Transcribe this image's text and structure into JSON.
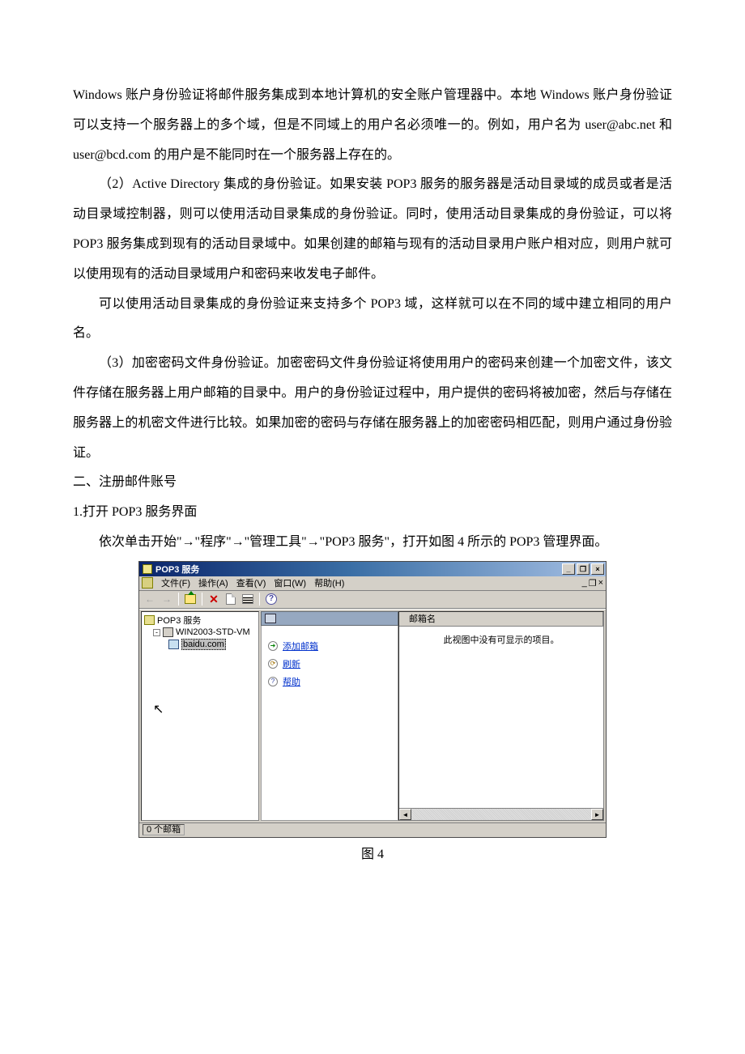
{
  "paragraphs": {
    "p1": "Windows 账户身份验证将邮件服务集成到本地计算机的安全账户管理器中。本地 Windows 账户身份验证可以支持一个服务器上的多个域，但是不同域上的用户名必须唯一的。例如，用户名为 user@abc.net 和 user@bcd.com 的用户是不能同时在一个服务器上存在的。",
    "p2": "（2）Active Directory 集成的身份验证。如果安装 POP3 服务的服务器是活动目录域的成员或者是活动目录域控制器，则可以使用活动目录集成的身份验证。同时，使用活动目录集成的身份验证，可以将 POP3 服务集成到现有的活动目录域中。如果创建的邮箱与现有的活动目录用户账户相对应，则用户就可以使用现有的活动目录域用户和密码来收发电子邮件。",
    "p3": "可以使用活动目录集成的身份验证来支持多个 POP3 域，这样就可以在不同的域中建立相同的用户名。",
    "p4": "（3）加密密码文件身份验证。加密密码文件身份验证将使用用户的密码来创建一个加密文件，该文件存储在服务器上用户邮箱的目录中。用户的身份验证过程中，用户提供的密码将被加密，然后与存储在服务器上的机密文件进行比较。如果加密的密码与存储在服务器上的加密密码相匹配，则用户通过身份验证。",
    "h2": "二、注册邮件账号",
    "h3": "1.打开 POP3 服务界面",
    "p5": "依次单击开始\"→\"程序\"→\"管理工具\"→\"POP3 服务\"，打开如图 4 所示的 POP3 管理界面。"
  },
  "win": {
    "title": "POP3 服务",
    "menus": {
      "file": "文件(F)",
      "action": "操作(A)",
      "view": "查看(V)",
      "window": "窗口(W)",
      "help": "帮助(H)"
    },
    "tree": {
      "root": "POP3 服务",
      "server": "WIN2003-STD-VM",
      "domain": "baidu.com"
    },
    "actions": {
      "add": "添加邮箱",
      "refresh": "刷新",
      "help": "帮助"
    },
    "list": {
      "col_name": "邮箱名",
      "empty": "此视图中没有可显示的项目。"
    },
    "status": "0 个邮箱"
  },
  "figcap": "图 4"
}
